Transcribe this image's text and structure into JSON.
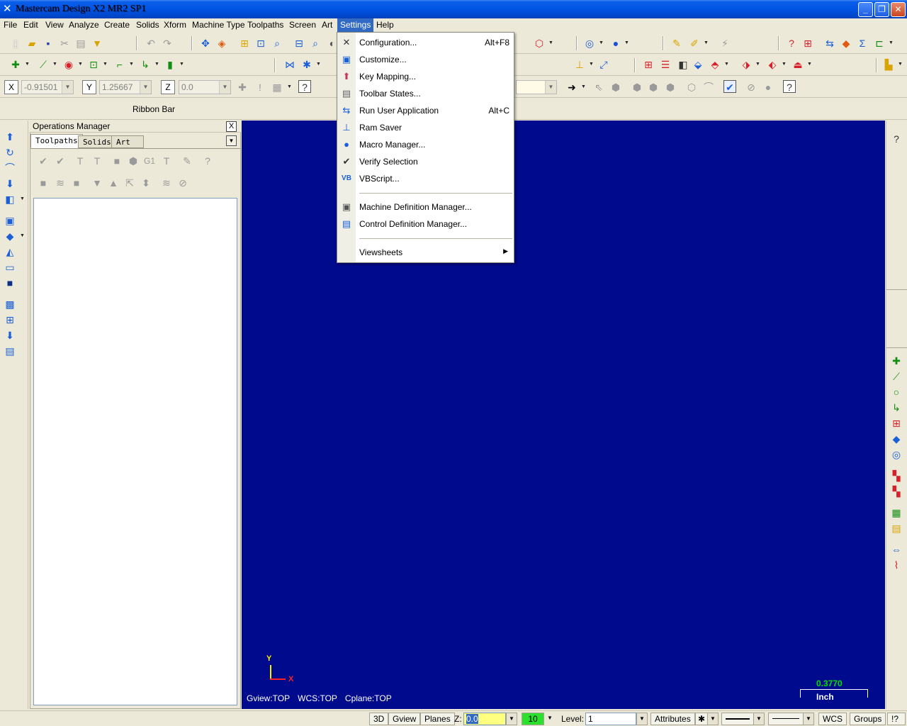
{
  "window": {
    "title": "Mastercam Design X2 MR2 SP1",
    "icon": "mastercam-logo-icon",
    "buttons": [
      "minimize",
      "maximize",
      "close"
    ]
  },
  "menubar": {
    "items": [
      "File",
      "Edit",
      "View",
      "Analyze",
      "Create",
      "Solids",
      "Xform",
      "Machine Type",
      "Toolpaths",
      "Screen",
      "Art",
      "Settings",
      "Help"
    ],
    "active": "Settings"
  },
  "settings_menu": {
    "items": [
      {
        "label": "Configuration...",
        "accel": "Alt+F8",
        "icon": "configuration-icon"
      },
      {
        "label": "Customize...",
        "accel": "",
        "icon": "customize-icon"
      },
      {
        "label": "Key Mapping...",
        "accel": "",
        "icon": "key-mapping-icon"
      },
      {
        "label": "Toolbar States...",
        "accel": "",
        "icon": "toolbar-states-icon"
      },
      {
        "label": "Run User Application",
        "accel": "Alt+C",
        "icon": "run-app-icon"
      },
      {
        "label": "Ram Saver",
        "accel": "",
        "icon": "ram-saver-icon"
      },
      {
        "label": "Macro Manager...",
        "accel": "",
        "icon": "macro-manager-icon"
      },
      {
        "label": "Verify Selection",
        "accel": "",
        "icon": "verify-selection-icon"
      },
      {
        "label": "VBScript...",
        "accel": "",
        "icon": "vbscript-icon"
      },
      {
        "label": "Machine Definition Manager...",
        "accel": "",
        "icon": "machine-definition-icon"
      },
      {
        "label": "Control Definition Manager...",
        "accel": "",
        "icon": "control-definition-icon"
      },
      {
        "label": "Viewsheets",
        "accel": "",
        "icon": "",
        "submenu": true
      }
    ]
  },
  "ribbon": {
    "x_label": "X",
    "x_value": "-0.91501",
    "y_label": "Y",
    "y_value": "1.25667",
    "z_label": "Z",
    "z_value": "0.0",
    "ribbon_bar_label": "Ribbon Bar"
  },
  "operations_manager": {
    "title": "Operations Manager",
    "close_label": "X",
    "tabs": [
      "Toolpaths",
      "Solids",
      "Art"
    ],
    "active_tab": "Toolpaths"
  },
  "viewport": {
    "background": "#000a8c",
    "axis_y": "Y",
    "axis_x": "X",
    "gview": "Gview:TOP",
    "wcs": "WCS:TOP",
    "cplane": "Cplane:TOP",
    "scale_value": "0.3770",
    "scale_unit": "Inch"
  },
  "statusbar": {
    "btn_3d": "3D",
    "btn_gview": "Gview",
    "btn_planes": "Planes",
    "z_label": "Z:",
    "z_value": "0.0",
    "color_value": "10",
    "level_label": "Level:",
    "level_value": "1",
    "attributes": "Attributes",
    "wcs": "WCS",
    "groups": "Groups",
    "help": "!?"
  }
}
